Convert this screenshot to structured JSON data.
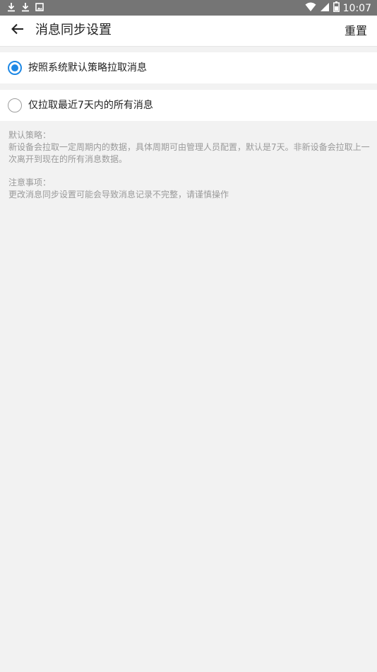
{
  "status_bar": {
    "time": "10:07",
    "left_icons": [
      "download-icon",
      "download-icon",
      "image-icon"
    ],
    "right_icons": [
      "wifi-icon",
      "signal-icon",
      "battery-icon"
    ]
  },
  "header": {
    "title": "消息同步设置",
    "reset_label": "重置",
    "back_icon": "arrow-left-icon"
  },
  "options": [
    {
      "label": "按照系统默认策略拉取消息",
      "selected": true
    },
    {
      "label": "仅拉取最近7天内的所有消息",
      "selected": false
    }
  ],
  "notes": {
    "default_title": "默认策略：",
    "default_text": "新设备会拉取一定周期内的数据，具体周期可由管理人员配置，默认是7天。非新设备会拉取上一次离开到现在的所有消息数据。",
    "notice_title": "注意事项：",
    "notice_text": "更改消息同步设置可能会导致消息记录不完整，请谨慎操作"
  },
  "colors": {
    "accent": "#1e88e5",
    "status_bar": "#757575",
    "background": "#f2f2f2",
    "note_text": "#9a9a9a"
  }
}
